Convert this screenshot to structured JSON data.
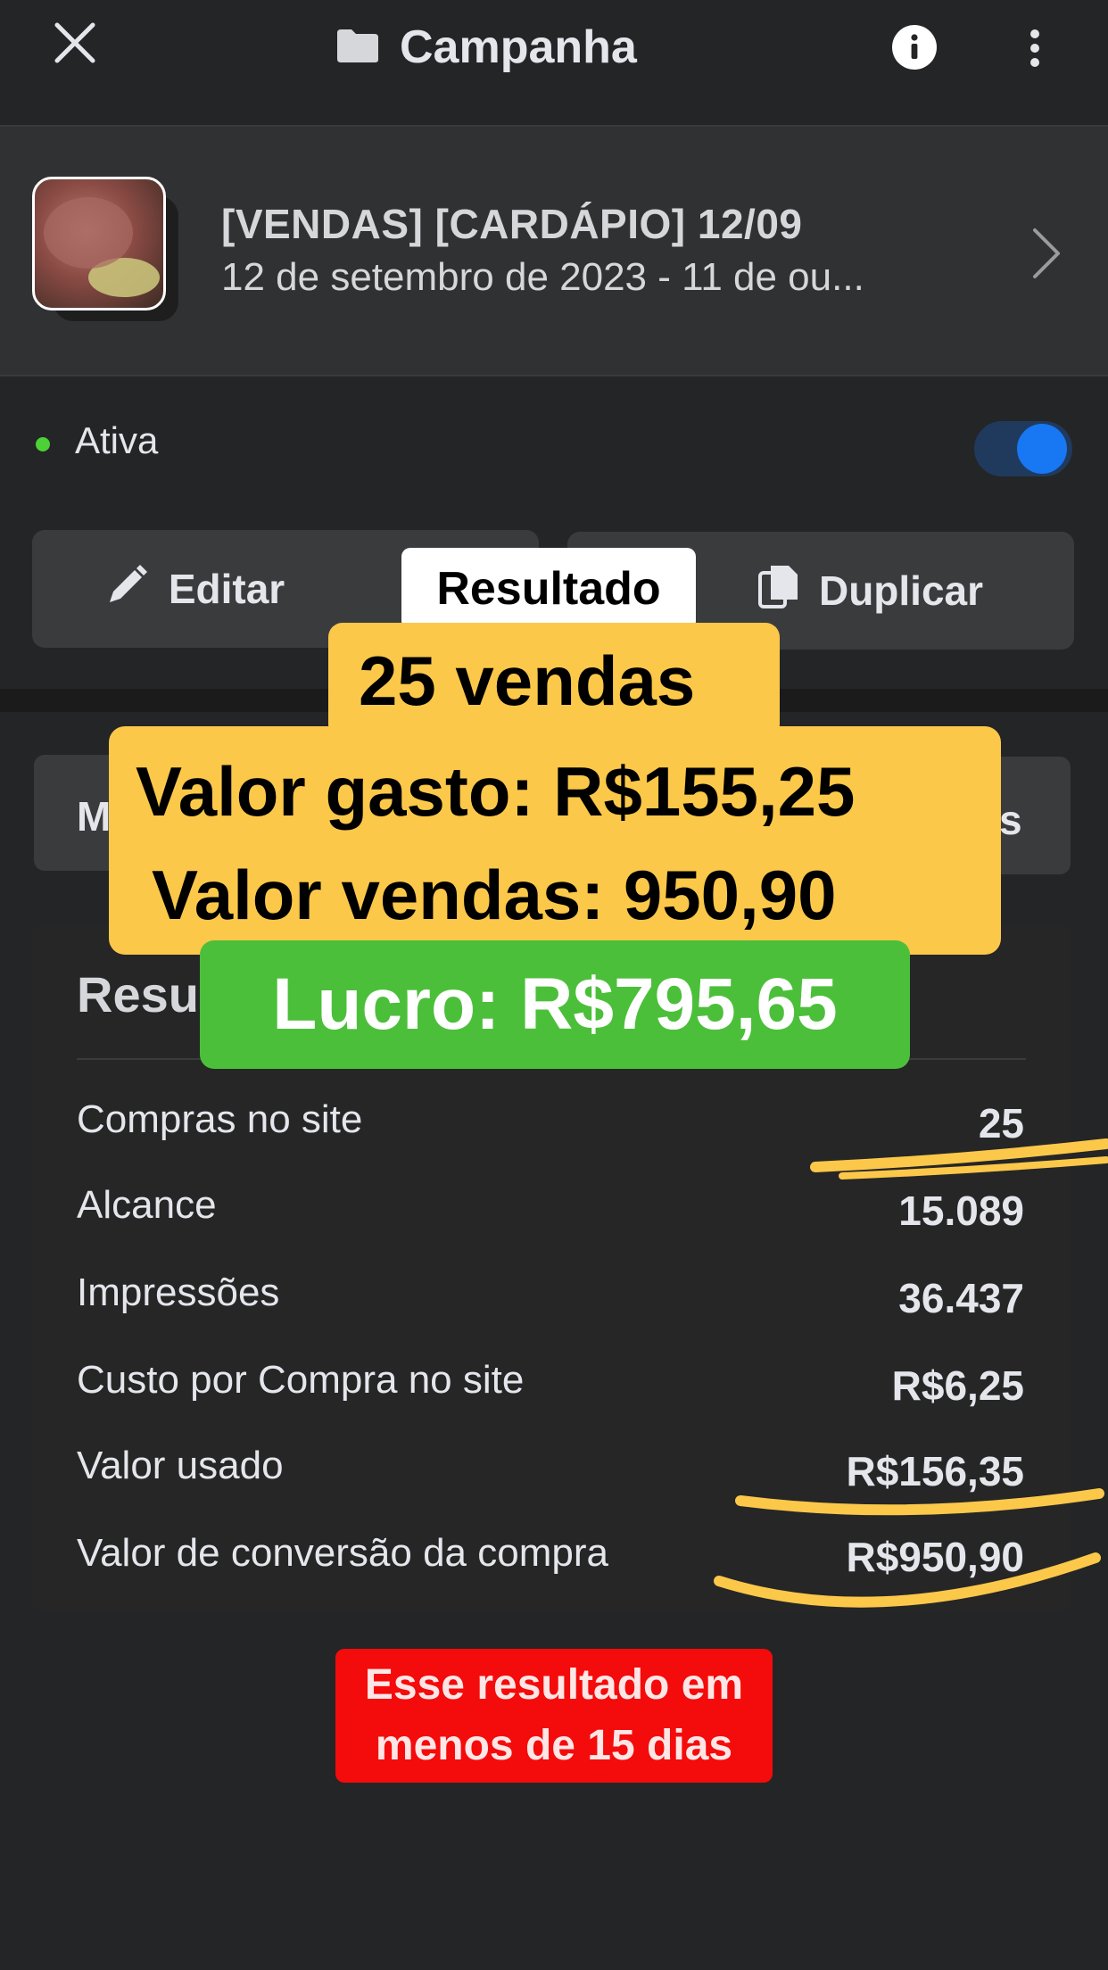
{
  "header": {
    "close_icon": "close-icon",
    "folder_icon": "folder-icon",
    "title": "Campanha",
    "info_icon": "info-icon",
    "more_icon": "more-vertical-icon"
  },
  "campaign": {
    "name": "[VENDAS] [CARDÁPIO] 12/09",
    "date_range": "12 de setembro de 2023 - 11 de ou...",
    "chevron_icon": "chevron-right-icon"
  },
  "status": {
    "label": "Ativa",
    "toggle_on": true,
    "dot_color": "#4cd137",
    "toggle_color": "#1877f2"
  },
  "actions": {
    "edit_label": "Editar",
    "edit_icon": "pencil-icon",
    "duplicate_label": "Duplicar",
    "duplicate_icon": "copy-icon"
  },
  "tabs": {
    "left_visible": "M",
    "right_visible": "s"
  },
  "results": {
    "title_visible": "Resu",
    "rows": [
      {
        "label": "Compras no site",
        "value": "25"
      },
      {
        "label": "Alcance",
        "value": "15.089"
      },
      {
        "label": "Impressões",
        "value": "36.437"
      },
      {
        "label": "Custo por Compra no site",
        "value": "R$6,25"
      },
      {
        "label": "Valor usado",
        "value": "R$156,35"
      },
      {
        "label": "Valor de conversão da compra",
        "value": "R$950,90"
      }
    ]
  },
  "overlay": {
    "tag": "Resultado",
    "line1": "25 vendas",
    "line2": "Valor gasto: R$155,25",
    "line3": "Valor vendas: 950,90",
    "profit": "Lucro: R$795,65",
    "note_line1": "Esse resultado em",
    "note_line2": "menos de 15 dias",
    "highlight_color": "#fcc84a",
    "profit_color": "#4cbf3a",
    "note_color": "#f40b0b"
  }
}
